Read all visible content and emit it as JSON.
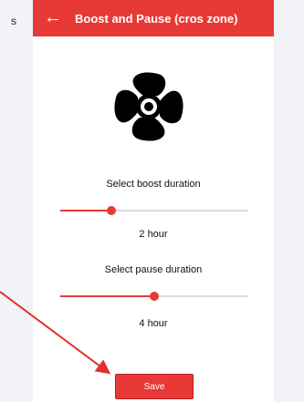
{
  "background_text": "s",
  "header": {
    "back_glyph": "←",
    "title": "Boost and Pause (cros zone)"
  },
  "fan_icon": "fan-icon",
  "boost": {
    "label": "Select boost duration",
    "value_label": "2 hour",
    "level": 0.27
  },
  "pause": {
    "label": "Select pause duration",
    "value_label": "4 hour",
    "level": 0.5
  },
  "save_label": "Save",
  "accent_color": "#e73a36"
}
